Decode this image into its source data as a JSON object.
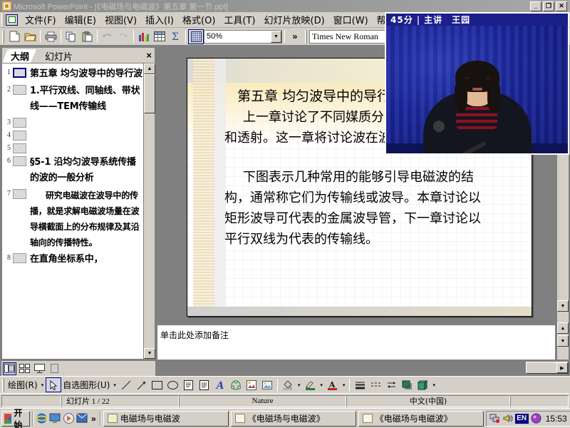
{
  "window": {
    "title": "Microsoft PowerPoint - [《电磁场与电磁波》第五章 第一节.ppt]",
    "minimize_label": "_",
    "restore_label": "❐",
    "close_label": "✕"
  },
  "menubar": {
    "items": [
      {
        "label": "文件(F)",
        "name": "menu-file"
      },
      {
        "label": "编辑(E)",
        "name": "menu-edit"
      },
      {
        "label": "视图(V)",
        "name": "menu-view"
      },
      {
        "label": "插入(I)",
        "name": "menu-insert"
      },
      {
        "label": "格式(O)",
        "name": "menu-format"
      },
      {
        "label": "工具(T)",
        "name": "menu-tools"
      },
      {
        "label": "幻灯片放映(D)",
        "name": "menu-slideshow"
      },
      {
        "label": "窗口(W)",
        "name": "menu-window"
      },
      {
        "label": "帮助(H)",
        "name": "menu-help"
      }
    ]
  },
  "toolbar": {
    "zoom_value": "50%",
    "font_value": "Times New Roman",
    "overflow_label": "»",
    "dropdown_arrow": "▼",
    "buttons": [
      {
        "name": "new-document-icon",
        "title": "新建"
      },
      {
        "name": "open-folder-icon",
        "title": "打开"
      },
      {
        "name": "print-icon",
        "title": "打印"
      },
      {
        "name": "copy-icon",
        "title": "复制"
      },
      {
        "name": "paste-icon",
        "title": "粘贴"
      },
      {
        "name": "undo-icon",
        "title": "撤消"
      },
      {
        "name": "redo-icon",
        "title": "恢复"
      },
      {
        "name": "chart-icon",
        "title": "图表"
      },
      {
        "name": "table-icon",
        "title": "表格"
      },
      {
        "name": "sum-icon",
        "title": "求和"
      },
      {
        "name": "grid-icon",
        "title": "网格"
      }
    ]
  },
  "outline_pane": {
    "tabs": [
      {
        "label": "大纲",
        "name": "tab-outline",
        "active": true
      },
      {
        "label": "幻灯片",
        "name": "tab-slides",
        "active": false
      }
    ],
    "close_label": "×",
    "items": [
      {
        "num": "1",
        "text": "第五章  均匀波导中的导行波",
        "selected": true,
        "level": 1
      },
      {
        "num": "2",
        "text": "1.平行双线、同轴线、带状线——TEM传输线",
        "selected": false,
        "level": 1
      },
      {
        "num": "3",
        "text": "",
        "selected": false,
        "level": 1
      },
      {
        "num": "4",
        "text": "",
        "selected": false,
        "level": 1
      },
      {
        "num": "5",
        "text": "",
        "selected": false,
        "level": 1
      },
      {
        "num": "6",
        "text": "§5-1  沿均匀波导系统传播的波的一般分析",
        "selected": false,
        "level": 1
      },
      {
        "num": "7",
        "text": "研究电磁波在波导中的传播，就是求解电磁波场量在波导横截面上的分布规律及其沿轴向的传播特性。",
        "selected": false,
        "level": 2
      },
      {
        "num": "8",
        "text": "在直角坐标系中，",
        "selected": false,
        "level": 1
      }
    ],
    "scroll_up": "▲",
    "scroll_down": "▼"
  },
  "view_buttons": [
    {
      "name": "view-normal",
      "label": "普通视图",
      "active": true
    },
    {
      "name": "view-slide-sorter",
      "label": "幻灯片浏览视图",
      "active": false
    },
    {
      "name": "view-slide-show",
      "label": "幻灯片放映",
      "active": false
    },
    {
      "name": "view-extra",
      "label": "",
      "active": false
    }
  ],
  "slide": {
    "title": "第五章  均匀波导中的导行波",
    "paragraphs": [
      "上一章讨论了不同媒质分界面上波的反射",
      "和透射。这一章将讨论波在波导中的传播。"
    ],
    "paragraphs2": [
      "下图表示几种常用的能够引导电磁波的结",
      "构，通常称它们为传输线或波导。本章讨论以",
      "矩形波导可代表的金属波导管，下一章讨论以",
      "平行双线为代表的传输线。"
    ]
  },
  "video_overlay": {
    "duration": "45分",
    "separator": "|",
    "role": "主讲",
    "speaker": "王园"
  },
  "notes": {
    "placeholder": "单击此处添加备注"
  },
  "slide_scroll": {
    "down_arrow": "▼",
    "prev_slide": "▲",
    "next_slide": "▼"
  },
  "drawing_toolbar": {
    "draw_label": "绘图(R)",
    "autoshapes_label": "自选图形(U)",
    "arrow": "▾",
    "buttons": [
      {
        "name": "select-arrow-icon"
      },
      {
        "name": "line-icon"
      },
      {
        "name": "arrow-icon"
      },
      {
        "name": "rectangle-icon"
      },
      {
        "name": "oval-icon"
      },
      {
        "name": "text-box-icon"
      },
      {
        "name": "vertical-text-box-icon"
      },
      {
        "name": "wordart-icon"
      },
      {
        "name": "diagram-icon"
      },
      {
        "name": "clip-art-icon"
      },
      {
        "name": "insert-picture-icon"
      },
      {
        "name": "fill-color-icon"
      },
      {
        "name": "line-color-icon"
      },
      {
        "name": "font-color-icon"
      },
      {
        "name": "line-style-icon"
      },
      {
        "name": "dash-style-icon"
      },
      {
        "name": "arrow-style-icon"
      },
      {
        "name": "shadow-style-icon"
      },
      {
        "name": "3d-style-icon"
      }
    ]
  },
  "statusbar": {
    "slide_counter": "幻灯片 1 / 22",
    "design_template": "Nature",
    "language": "中文(中国)"
  },
  "taskbar": {
    "start_label": "开始",
    "quick_launch": [
      {
        "name": "internet-explorer-icon"
      },
      {
        "name": "show-desktop-icon"
      },
      {
        "name": "media-player-icon"
      },
      {
        "name": "outlook-icon"
      }
    ],
    "overflow": "»",
    "tasks": [
      {
        "label": "电磁场与电磁波",
        "icon": "folder-icon",
        "name": "taskbar-item-folder"
      },
      {
        "label": "《电磁场与电磁波》",
        "icon": "powerpoint-icon",
        "name": "taskbar-item-ppt-1"
      },
      {
        "label": "《电磁场与电磁波》",
        "icon": "powerpoint-icon",
        "name": "taskbar-item-ppt-2"
      }
    ],
    "tray": [
      {
        "name": "network-icon"
      },
      {
        "name": "volume-icon"
      }
    ],
    "input_language": "EN",
    "clock": "15:53"
  },
  "colors": {
    "window_face": "#d4d0c8",
    "title_inactive": "#9a9a9a",
    "accent_navy": "#000080",
    "video_blue": "#1a259a",
    "slide_parchment": "#f3ecd2"
  }
}
